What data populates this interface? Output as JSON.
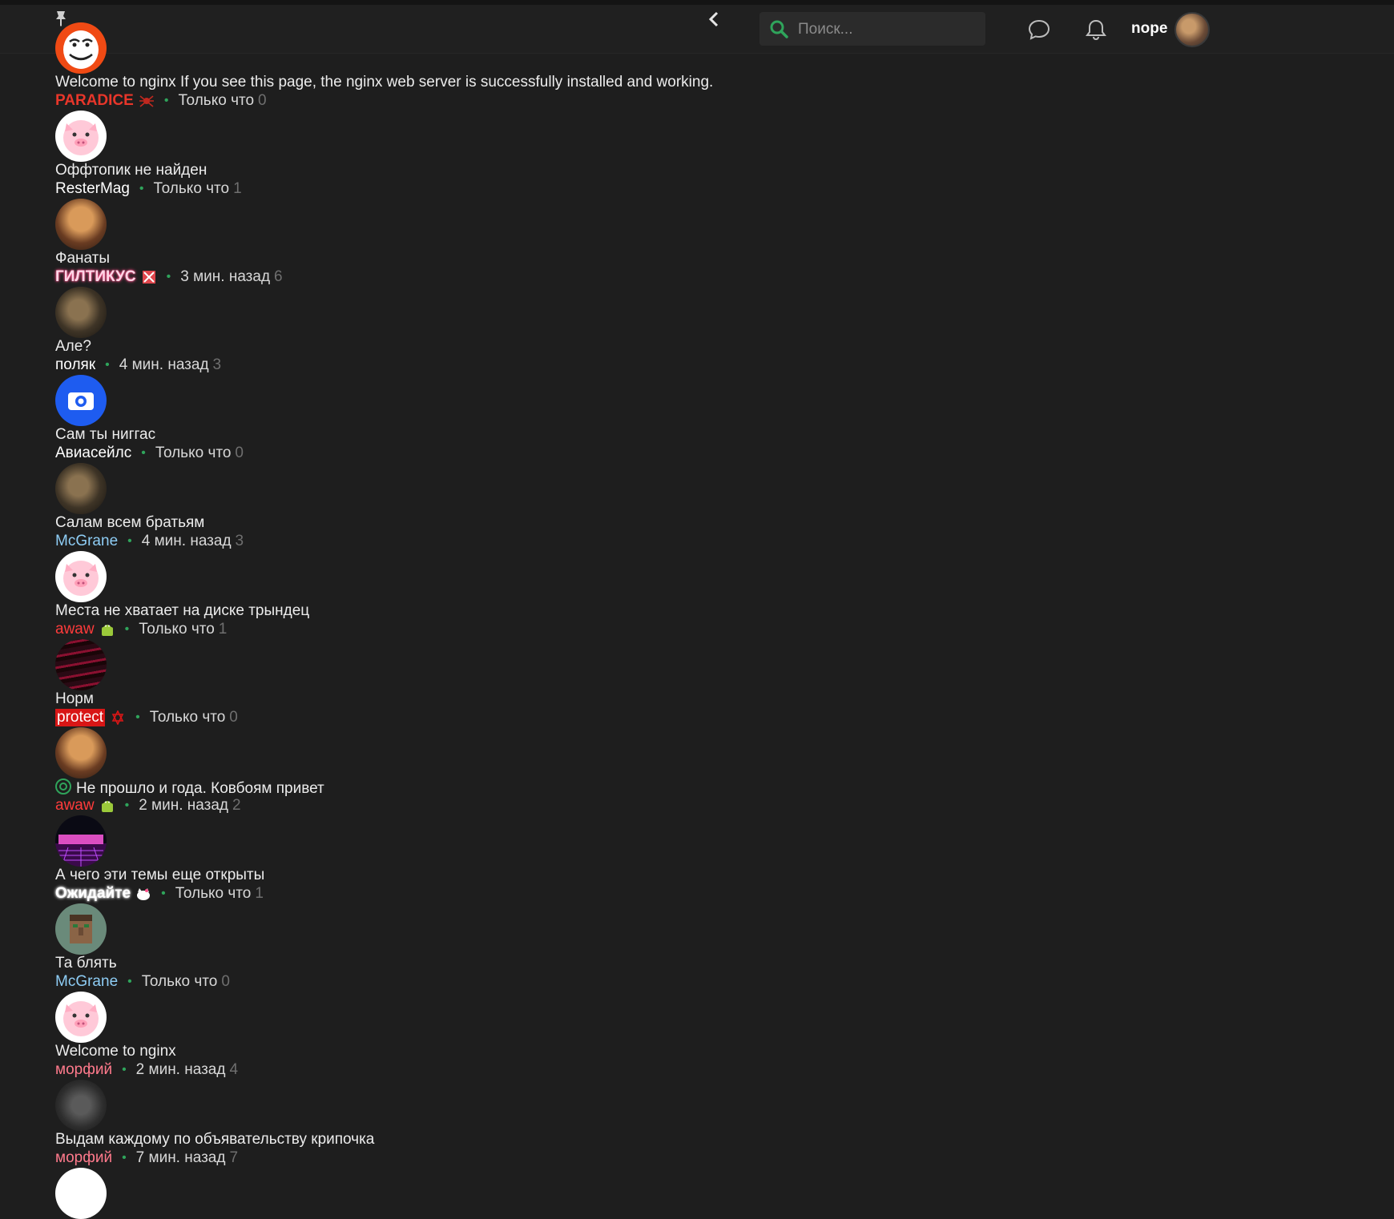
{
  "header": {
    "search": {
      "placeholder": "Поиск..."
    },
    "user": {
      "name": "nope"
    }
  },
  "topics": [
    {
      "title": "Welcome to nginx If you see this page, the nginx web server is successfully installed and working.",
      "author": "PARADICE",
      "author_color": "#e8362a",
      "time": "Только что",
      "count": "0"
    },
    {
      "title": "Оффтопик не найден",
      "author": "ResterMag",
      "author_color": "#ffffff",
      "time": "Только что",
      "count": "1"
    },
    {
      "title": "Фанаты",
      "author": "ГИЛТИКУС",
      "author_color": "#ffd6e6",
      "time": "3 мин. назад",
      "count": "6"
    },
    {
      "title": "Але?",
      "author": "поляк",
      "author_color": "#ffffff",
      "time": "4 мин. назад",
      "count": "3"
    },
    {
      "title": "Сам ты ниггас",
      "author": "Авиасейлс",
      "author_color": "#ffffff",
      "time": "Только что",
      "count": "0"
    },
    {
      "title": "Салам всем братьям",
      "author": "McGrane",
      "author_color": "#8ecdf5",
      "time": "4 мин. назад",
      "count": "3"
    },
    {
      "title": "Места не хватает на диске трындец",
      "author": "awaw",
      "author_color": "#ff3b3b",
      "time": "Только что",
      "count": "1"
    },
    {
      "title": "Норм",
      "author": "protect",
      "author_color": "#ffffff",
      "time": "Только что",
      "count": "0"
    },
    {
      "title": "Не прошло и года. Ковбоям привет",
      "author": "awaw",
      "author_color": "#ff3b3b",
      "time": "2 мин. назад",
      "count": "2"
    },
    {
      "title": "А чего эти темы еще открыты",
      "author": "Ожидайте",
      "author_color": "#ffffff",
      "time": "Только что",
      "count": "1"
    },
    {
      "title": "Та блять",
      "author": "McGrane",
      "author_color": "#8ecdf5",
      "time": "Только что",
      "count": "0"
    },
    {
      "title": "Welcome to nginx",
      "author": "морфий",
      "author_color": "#ff7a8c",
      "time": "2 мин. назад",
      "count": "4"
    },
    {
      "title": "Выдам каждому по объявательству крипочка",
      "author": "морфий",
      "author_color": "#ff7a8c",
      "time": "7 мин. назад",
      "count": "7"
    }
  ]
}
